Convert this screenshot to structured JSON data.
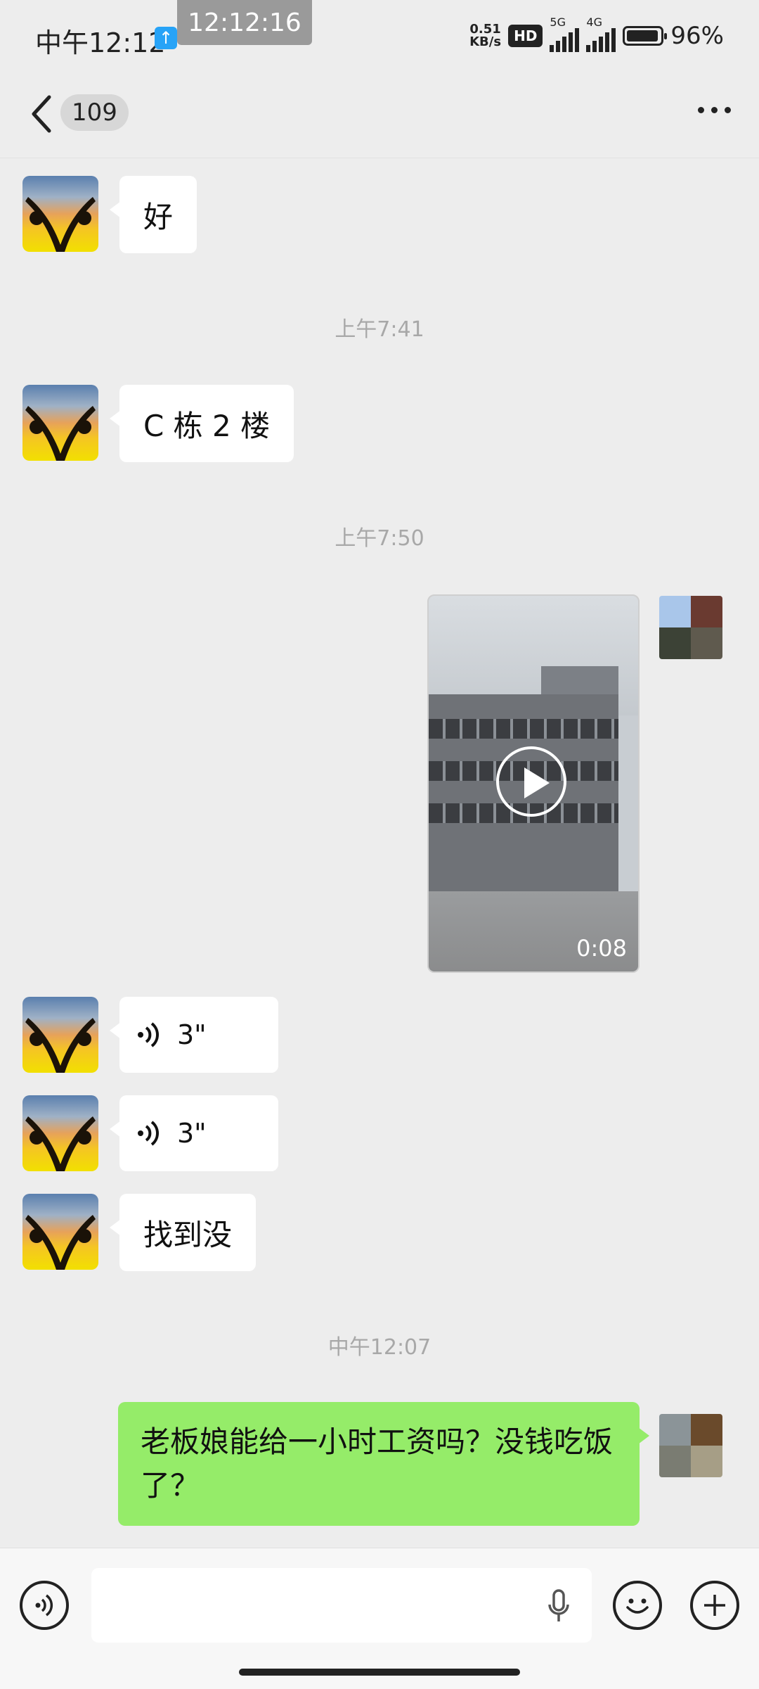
{
  "status_bar": {
    "time": "中午12:12",
    "clock_overlay": "12:12:16",
    "net_speed_value": "0.51",
    "net_speed_unit": "KB/s",
    "hd_badge": "HD",
    "sim1_label": "5G",
    "sim2_label": "4G",
    "battery_percent": "96%",
    "battery_level": 0.96
  },
  "header": {
    "unread_count": "109"
  },
  "messages": {
    "m1_text": "好",
    "ts1": "上午7:41",
    "m2_text": "C 栋 2 楼",
    "ts2": "上午7:50",
    "video_duration": "0:08",
    "voice1_duration": "3\"",
    "voice2_duration": "3\"",
    "m5_text": "找到没",
    "ts3": "中午12:07",
    "m6_text": "老板娘能给一小时工资吗？没钱吃饭了？"
  },
  "icons": {
    "back": "chevron-left-icon",
    "more": "more-dots-icon",
    "voice": "voice-wave-icon",
    "mic": "microphone-icon",
    "emoji": "emoji-icon",
    "plus": "plus-icon",
    "play": "play-icon"
  },
  "colors": {
    "background": "#ededed",
    "bubble_white": "#ffffff",
    "bubble_green": "#95ec69",
    "timestamp": "#a8a8a8"
  }
}
